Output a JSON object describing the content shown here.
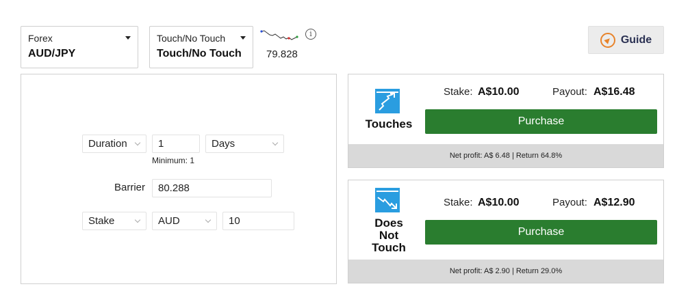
{
  "market": {
    "category": "Forex",
    "symbol": "AUD/JPY"
  },
  "trade_type": {
    "category": "Touch/No Touch",
    "selected": "Touch/No Touch"
  },
  "spot": {
    "value": "79.828",
    "info_glyph": "i"
  },
  "guide": {
    "label": "Guide",
    "icon": "compass-icon"
  },
  "params": {
    "duration": {
      "type": "Duration",
      "value": "1",
      "unit": "Days",
      "hint": "Minimum: 1"
    },
    "barrier": {
      "label": "Barrier",
      "value": "80.288"
    },
    "stake": {
      "type": "Stake",
      "currency": "AUD",
      "amount": "10"
    }
  },
  "contracts": [
    {
      "title": "Touches",
      "icon": "touches-icon",
      "stake_label": "Stake:",
      "stake_value": "A$10.00",
      "payout_label": "Payout:",
      "payout_value": "A$16.48",
      "button": "Purchase",
      "footer": "Net profit:  A$ 6.48 | Return 64.8%"
    },
    {
      "title_lines": [
        "Does",
        "Not",
        "Touch"
      ],
      "icon": "does-not-touch-icon",
      "stake_label": "Stake:",
      "stake_value": "A$10.00",
      "payout_label": "Payout:",
      "payout_value": "A$12.90",
      "button": "Purchase",
      "footer": "Net profit:  A$ 2.90 | Return 29.0%"
    }
  ],
  "colors": {
    "purchase": "#2a7d2f",
    "contract_icon": "#2a9de0",
    "guide_accent": "#e8832a"
  }
}
